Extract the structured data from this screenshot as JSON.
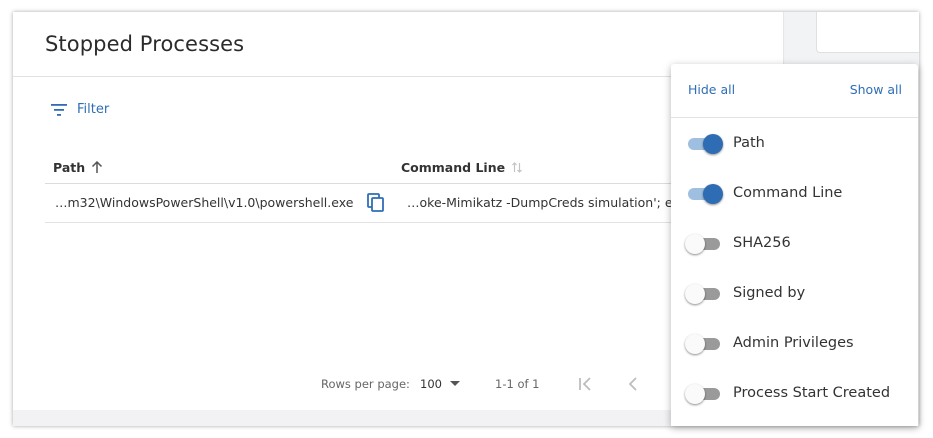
{
  "page": {
    "title": "Stopped Processes",
    "filter_label": "Filter"
  },
  "table": {
    "columns": [
      {
        "label": "Path",
        "sort_icon": "arrow-up-icon"
      },
      {
        "label": "Command Line",
        "sort_icon": "sort-icon"
      }
    ],
    "rows": [
      {
        "path": "…m32\\WindowsPowerShell\\v1.0\\powershell.exe",
        "command_line": "…oke-Mimikatz -DumpCreds simulation'; e"
      }
    ]
  },
  "pagination": {
    "rows_per_page_label": "Rows per page:",
    "rows_per_page_value": "100",
    "range": "1-1 of 1"
  },
  "column_menu": {
    "hide_all": "Hide all",
    "show_all": "Show all",
    "options": [
      {
        "label": "Path",
        "enabled": true
      },
      {
        "label": "Command Line",
        "enabled": true
      },
      {
        "label": "SHA256",
        "enabled": false
      },
      {
        "label": "Signed by",
        "enabled": false
      },
      {
        "label": "Admin Privileges",
        "enabled": false
      },
      {
        "label": "Process Start Created",
        "enabled": false
      }
    ]
  },
  "colors": {
    "accent": "#2f6eb5",
    "switch_on": "#2e6db3",
    "switch_on_track": "#9ebfdf",
    "switch_off_track": "#9a9a9a"
  }
}
